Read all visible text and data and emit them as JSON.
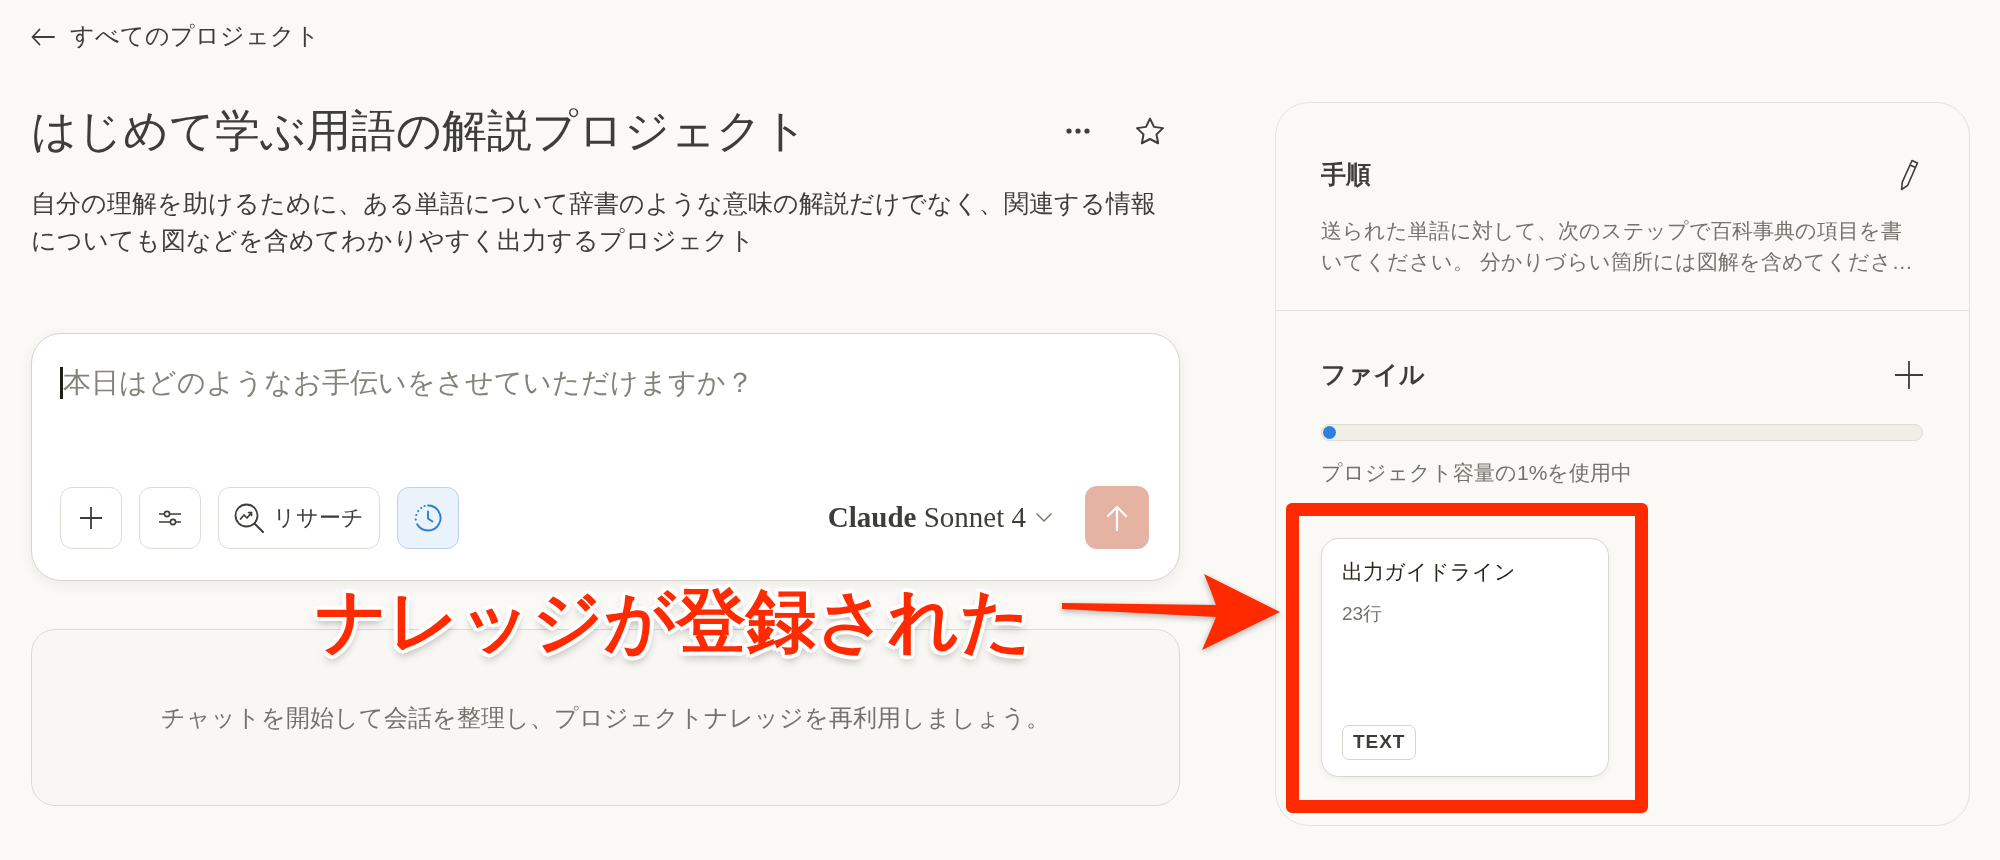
{
  "back_link": {
    "label": "すべてのプロジェクト"
  },
  "project": {
    "title": "はじめて学ぶ用語の解説プロジェクト",
    "starred": false,
    "description": "自分の理解を助けるために、ある単語について辞書のような意味の解説だけでなく、関連する情報についても図などを含めてわかりやすく出力するプロジェクト"
  },
  "composer": {
    "placeholder": "本日はどのようなお手伝いをさせていただけますか？",
    "tools": [
      {
        "kind": "plus",
        "on": false
      },
      {
        "kind": "sliders",
        "on": false
      },
      {
        "kind": "research",
        "label": "リサーチ",
        "on": false
      },
      {
        "kind": "clock",
        "on": true
      }
    ],
    "model": "**Claude** Sonnet 4",
    "send": {
      "disabled": true
    }
  },
  "chats": {
    "empty_message": "チャットを開始して会話を整理し、プロジェクトナレッジを再利用しましょう。"
  },
  "instructions": {
    "title": "手順",
    "text": "送られた単語に対して、次のステップで百科事典の項目を書いてください。 分かりづらい箇所には図解を含めてくださ…"
  },
  "files": {
    "title": "ファイル",
    "usage": {
      "level": 0.01,
      "label": "プロジェクト容量の1%を使用中"
    },
    "items": [
      {
        "name": "出力ガイドライン",
        "lines": "23行",
        "type": "TEXT"
      }
    ]
  },
  "annotation": {
    "text": "ナレッジが登録された"
  }
}
